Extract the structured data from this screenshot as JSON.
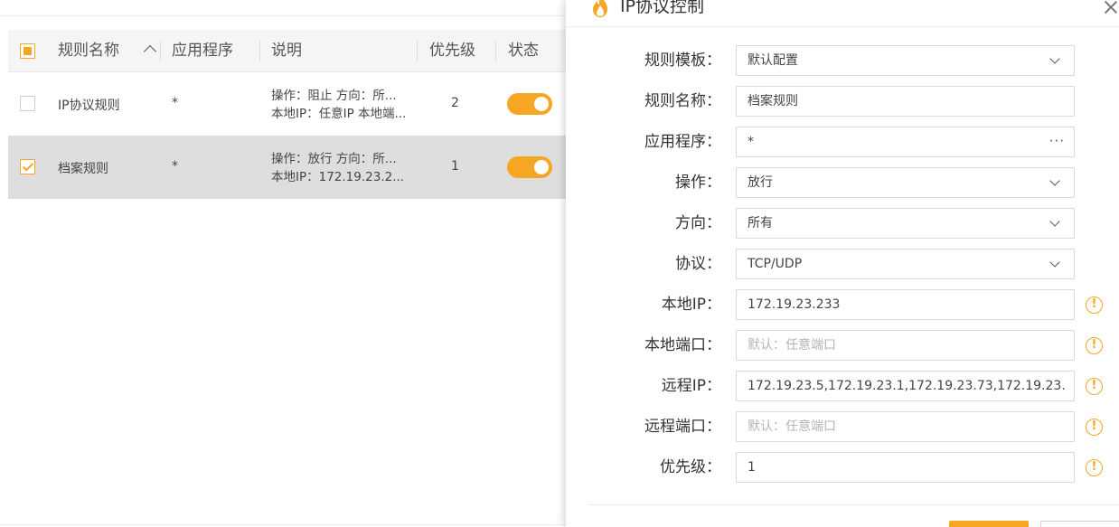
{
  "table": {
    "headers": {
      "name": "规则名称",
      "app": "应用程序",
      "desc": "说明",
      "priority": "优先级",
      "status": "状态"
    },
    "rows": [
      {
        "name": "IP协议规则",
        "app": "*",
        "desc_line1": "操作：阻止 方向：所...",
        "desc_line2": "本地IP：任意IP 本地端...",
        "priority": "2",
        "checked": false,
        "enabled": true
      },
      {
        "name": "档案规则",
        "app": "*",
        "desc_line1": "操作：放行 方向：所...",
        "desc_line2": "本地IP：172.19.23.2...",
        "priority": "1",
        "checked": true,
        "enabled": true
      }
    ]
  },
  "dialog": {
    "title": "IP协议控制",
    "fields": [
      {
        "label": "规则模板：",
        "value": "默认配置",
        "type": "select"
      },
      {
        "label": "规则名称：",
        "value": "档案规则",
        "type": "text"
      },
      {
        "label": "应用程序：",
        "value": "*",
        "type": "picker",
        "picker_glyph": "···"
      },
      {
        "label": "操作：",
        "value": "放行",
        "type": "select"
      },
      {
        "label": "方向：",
        "value": "所有",
        "type": "select"
      },
      {
        "label": "协议：",
        "value": "TCP/UDP",
        "type": "select"
      },
      {
        "label": "本地IP：",
        "value": "172.19.23.233",
        "type": "text",
        "warn": true
      },
      {
        "label": "本地端口：",
        "placeholder": "默认：任意端口",
        "type": "text",
        "warn": true
      },
      {
        "label": "远程IP：",
        "value": "172.19.23.5,172.19.23.1,172.19.23.73,172.19.23.",
        "type": "text",
        "warn": true
      },
      {
        "label": "远程端口：",
        "placeholder": "默认：任意端口",
        "type": "text",
        "warn": true
      },
      {
        "label": "优先级：",
        "value": "1",
        "type": "text",
        "warn": true
      }
    ],
    "warn_glyph": "!"
  },
  "colors": {
    "accent": "#f5a623",
    "selected_row": "#dedede",
    "header_bg": "#f5f5f5"
  }
}
